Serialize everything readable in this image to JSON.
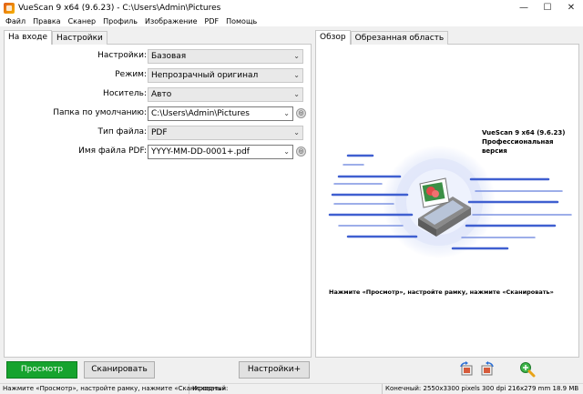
{
  "window": {
    "title": "VueScan 9 x64 (9.6.23) - C:\\Users\\Admin\\Pictures"
  },
  "menu": [
    "Файл",
    "Правка",
    "Сканер",
    "Профиль",
    "Изображение",
    "PDF",
    "Помощь"
  ],
  "left_tabs": [
    "На входе",
    "Настройки"
  ],
  "right_tabs": [
    "Обзор",
    "Обрезанная область"
  ],
  "form": {
    "settings": {
      "label": "Настройки:",
      "value": "Базовая"
    },
    "mode": {
      "label": "Режим:",
      "value": "Непрозрачный оригинал"
    },
    "media": {
      "label": "Носитель:",
      "value": "Авто"
    },
    "default_folder": {
      "label": "Папка по умолчанию:",
      "value": "C:\\Users\\Admin\\Pictures"
    },
    "file_type": {
      "label": "Тип файла:",
      "value": "PDF"
    },
    "pdf_name": {
      "label": "Имя файла PDF:",
      "value": "YYYY-MM-DD-0001+.pdf"
    }
  },
  "preview": {
    "brand_line1": "VueScan 9 x64 (9.6.23)",
    "brand_line2": "Профессиональная версия",
    "hint": "Нажмите «Просмотр», настройте рамку, нажмите «Сканировать»"
  },
  "buttons": {
    "preview": "Просмотр",
    "scan": "Сканировать",
    "more": "Настройки+"
  },
  "status": {
    "left": "Нажмите «Просмотр», настройте рамку, нажмите «Сканировать»",
    "source": "Исходный:",
    "output": "Конечный: 2550x3300 pixels 300 dpi 216x279 mm 18.9 MB"
  },
  "colors": {
    "accent_green": "#16a32e",
    "stripe_blue": "#3f5fd0"
  }
}
